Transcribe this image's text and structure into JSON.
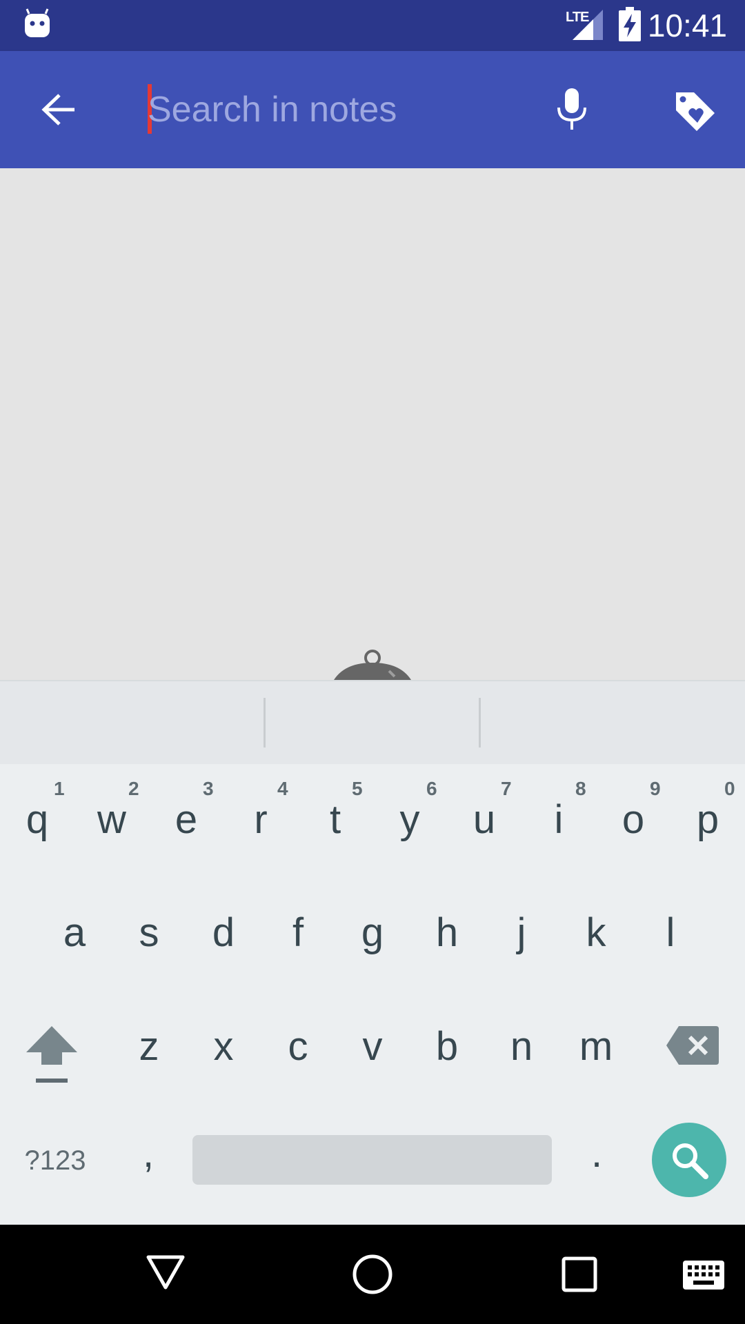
{
  "status_bar": {
    "network": "LTE",
    "time": "10:41",
    "icons": [
      "android-notification-icon",
      "signal-icon",
      "battery-charging-icon"
    ]
  },
  "app_bar": {
    "search": {
      "value": "",
      "placeholder": "Search in notes"
    },
    "icons": [
      "back-arrow-icon",
      "microphone-icon",
      "tag-heart-icon"
    ]
  },
  "keyboard": {
    "row1": [
      "q",
      "w",
      "e",
      "r",
      "t",
      "y",
      "u",
      "i",
      "o",
      "p"
    ],
    "row1_hints": [
      "1",
      "2",
      "3",
      "4",
      "5",
      "6",
      "7",
      "8",
      "9",
      "0"
    ],
    "row2": [
      "a",
      "s",
      "d",
      "f",
      "g",
      "h",
      "j",
      "k",
      "l"
    ],
    "row3": [
      "z",
      "x",
      "c",
      "v",
      "b",
      "n",
      "m"
    ],
    "row4": {
      "symbols": "?123",
      "comma": ",",
      "period": "."
    },
    "icons": [
      "shift-icon",
      "backspace-icon",
      "search-icon"
    ]
  },
  "nav_bar": {
    "icons": [
      "back-triangle-icon",
      "home-circle-icon",
      "recents-square-icon",
      "keyboard-switch-icon"
    ]
  },
  "colors": {
    "status_bar": "#2b378b",
    "app_bar": "#3f51b5",
    "cursor": "#e53935",
    "search_action": "#4db6ac",
    "keyboard_bg": "#eceff1"
  }
}
